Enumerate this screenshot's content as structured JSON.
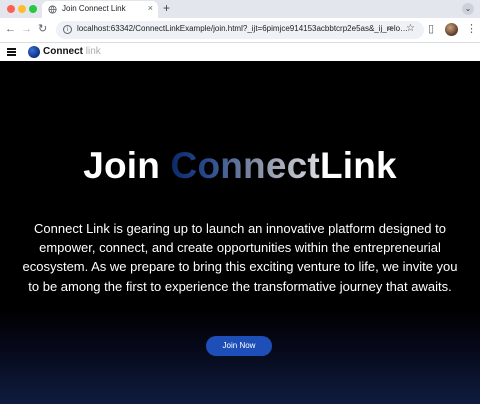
{
  "browser": {
    "tab_title": "Join Connect Link",
    "new_tab_label": "+",
    "tab_close": "×",
    "url": "localhost:63342/ConnectLinkExample/join.html?_ijt=6pimjce914153acbbtcrp2e5as&_ij_relo…",
    "icons": [
      "back-icon",
      "forward-icon",
      "reload-icon",
      "info-icon",
      "zoom-icon",
      "star-icon",
      "sidebar-icon",
      "profile-avatar",
      "kebab-menu-icon"
    ]
  },
  "nav": {
    "logo_primary": "Connect",
    "logo_secondary": "link"
  },
  "hero": {
    "title_lead": "Join ",
    "title_accent": "Connect",
    "title_tail": "Link",
    "description": "Connect Link is gearing up to launch an innovative platform designed to empower, connect, and create opportunities within the entrepreneurial ecosystem. As we prepare to bring this exciting venture to life, we invite you to be among the first to experience the transformative journey that awaits.",
    "cta_label": "Join Now"
  },
  "colors": {
    "accent": "#1e4fb8",
    "hero_background": "#000000"
  }
}
